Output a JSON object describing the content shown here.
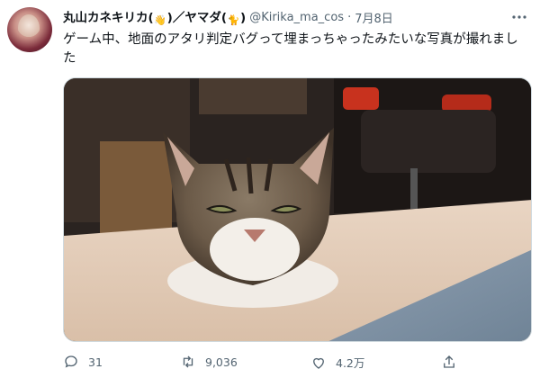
{
  "tweet": {
    "display_name": "丸山カネキリカ(",
    "emoji_1": "👋",
    "name_mid": ")／ヤマダ(",
    "emoji_2": "🐈",
    "name_end": ")",
    "handle": "@Kirika_ma_cos",
    "separator": "·",
    "date": "7月8日",
    "text": "ゲーム中、地面のアタリ判定バグって埋まっちゃったみたいな写真が撮れました"
  },
  "actions": {
    "reply_count": "31",
    "retweet_count": "9,036",
    "like_count": "4.2万"
  },
  "icons": [
    "more-icon",
    "reply-icon",
    "retweet-icon",
    "like-icon",
    "share-icon"
  ],
  "colors": {
    "text": "#0f1419",
    "secondary": "#536471",
    "border": "#cfd9de"
  }
}
